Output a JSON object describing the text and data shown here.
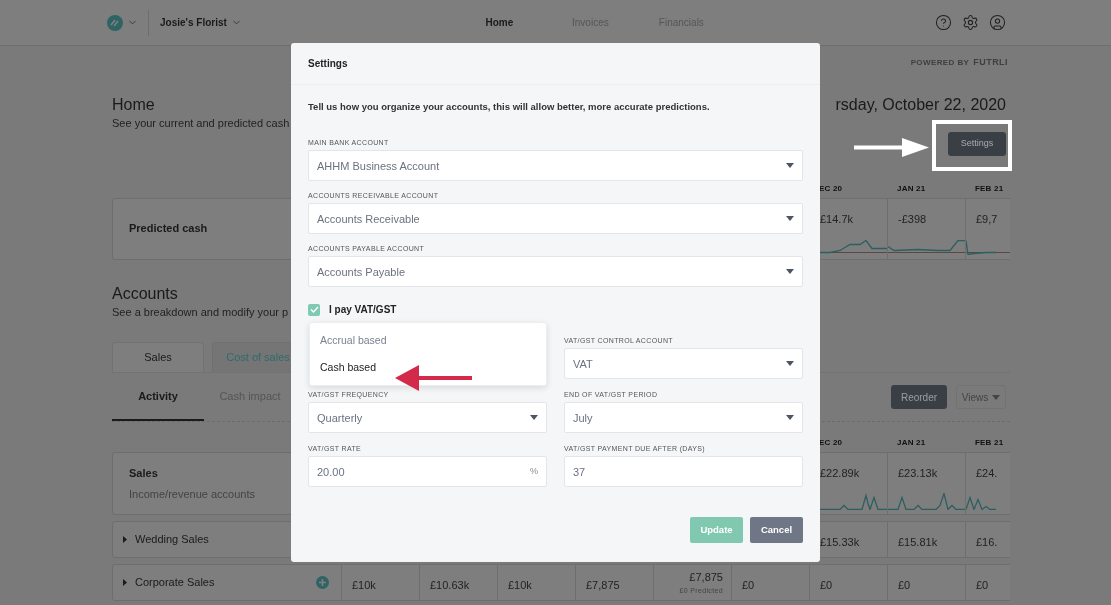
{
  "nav": {
    "account": "Josie's Florist",
    "tabs": [
      {
        "label": "Home",
        "selected": true
      },
      {
        "label": "Invoices",
        "selected": false
      },
      {
        "label": "Financials",
        "selected": false
      }
    ]
  },
  "powered_by": {
    "label": "POWERED BY",
    "brand": "FUTRLI"
  },
  "home": {
    "title": "Home",
    "subtitle": "See your current and predicted cash",
    "date": "rsday, October 22, 2020",
    "settings_button": "Settings"
  },
  "forecast_months": [
    "EC 20",
    "JAN 21",
    "FEB 21"
  ],
  "predicted_cash": {
    "label": "Predicted cash",
    "values": [
      "£14.7k",
      "-£398",
      "£9,7"
    ]
  },
  "accounts": {
    "title": "Accounts",
    "subtitle": "See a breakdown and modify your p",
    "category_tabs": [
      {
        "label": "Sales",
        "selected": true
      },
      {
        "label": "Cost of sales",
        "selected": false
      }
    ],
    "view_tabs": [
      {
        "label": "Activity",
        "selected": true
      },
      {
        "label": "Cash impact",
        "selected": false
      }
    ],
    "reorder_button": "Reorder",
    "views_button": "Views"
  },
  "activity_months": [
    "EC 20",
    "JAN 21",
    "FEB 21"
  ],
  "sales": {
    "title": "Sales",
    "subtitle": "Income/revenue accounts",
    "values": [
      "£22.89k",
      "£23.13k",
      "£24."
    ]
  },
  "rows": [
    {
      "name": "Wedding Sales",
      "cells": [
        {
          "value": "£15.33k"
        },
        {
          "value": "£15.81k"
        },
        {
          "value": "£16."
        }
      ]
    },
    {
      "name": "Corporate Sales",
      "addable": true,
      "cells": [
        {
          "value": "£10k"
        },
        {
          "value": "£10.63k"
        },
        {
          "value": "£10k"
        },
        {
          "value": "£7,875"
        },
        {
          "value": "£7,875",
          "note": "£0 Predicted"
        },
        {
          "value": "£0"
        },
        {
          "value": "£0"
        },
        {
          "value": "£0"
        },
        {
          "value": "£0"
        }
      ]
    }
  ],
  "settings_dialog": {
    "title": "Settings",
    "intro": "Tell us how you organize your accounts, this will allow better, more accurate predictions.",
    "fields": [
      {
        "label": "MAIN BANK ACCOUNT",
        "value": "AHHM Business Account",
        "kind": "select"
      },
      {
        "label": "ACCOUNTS RECEIVABLE ACCOUNT",
        "value": "Accounts Receivable",
        "kind": "select"
      },
      {
        "label": "ACCOUNTS PAYABLE ACCOUNT",
        "value": "Accounts Payable",
        "kind": "select"
      }
    ],
    "vat_checkbox": {
      "label": "I pay VAT/GST",
      "checked": true
    },
    "basis_menu": {
      "options": [
        {
          "label": "Accrual based",
          "selected": false
        },
        {
          "label": "Cash based",
          "selected": true
        }
      ]
    },
    "vat_fields": [
      {
        "kind": "menu"
      },
      {
        "label": "VAT/GST CONTROL ACCOUNT",
        "value": "VAT",
        "kind": "select"
      },
      {
        "label": "VAT/GST FREQUENCY",
        "value": "Quarterly",
        "kind": "select"
      },
      {
        "label": "END OF VAT/GST PERIOD",
        "value": "July",
        "kind": "select"
      },
      {
        "label": "VAT/GST RATE",
        "value": "20.00",
        "suffix": "%",
        "kind": "input"
      },
      {
        "label": "VAT/GST PAYMENT DUE AFTER (DAYS)",
        "value": "37",
        "kind": "input"
      }
    ],
    "buttons": [
      {
        "label": "Update",
        "kind": "primary"
      },
      {
        "label": "Cancel",
        "kind": "secondary"
      }
    ]
  }
}
